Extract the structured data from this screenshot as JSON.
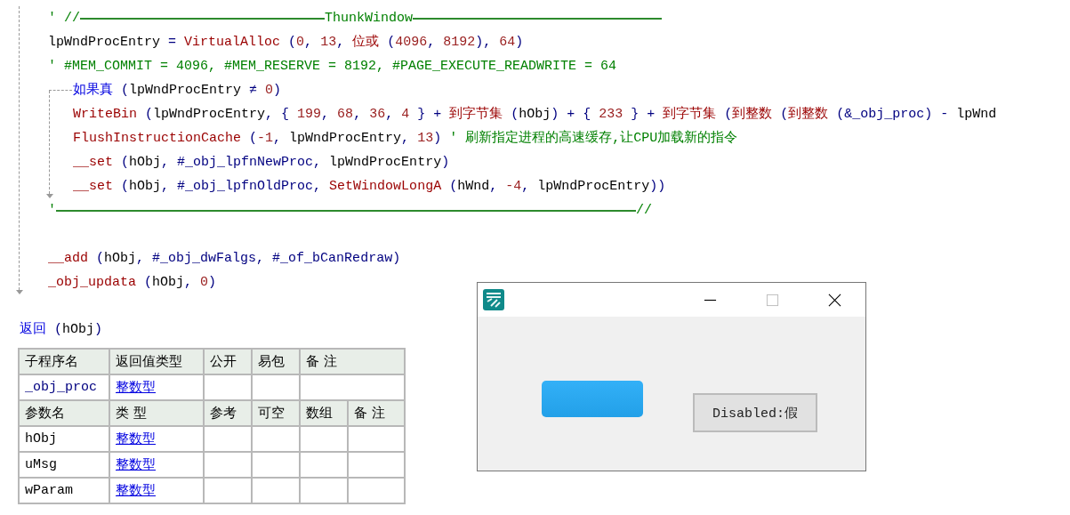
{
  "code": [
    {
      "kind": "rule",
      "prefix": "' //",
      "title": "ThunkWindow"
    },
    {
      "kind": "code",
      "tokens": [
        {
          "text": "lpWndProcEntry",
          "kind": "id"
        },
        {
          "text": " = ",
          "kind": "op"
        },
        {
          "text": "VirtualAlloc",
          "kind": "fn"
        },
        {
          "text": " (",
          "kind": "op"
        },
        {
          "text": "0",
          "kind": "num"
        },
        {
          "text": ", ",
          "kind": "op"
        },
        {
          "text": "13",
          "kind": "num"
        },
        {
          "text": ", ",
          "kind": "op"
        },
        {
          "text": "位或",
          "kind": "fn"
        },
        {
          "text": " (",
          "kind": "op"
        },
        {
          "text": "4096",
          "kind": "num"
        },
        {
          "text": ", ",
          "kind": "op"
        },
        {
          "text": "8192",
          "kind": "num"
        },
        {
          "text": "), ",
          "kind": "op"
        },
        {
          "text": "64",
          "kind": "num"
        },
        {
          "text": ")",
          "kind": "op"
        }
      ]
    },
    {
      "kind": "code",
      "tokens": [
        {
          "text": "' #MEM_COMMIT = 4096, #MEM_RESERVE = 8192, #PAGE_EXECUTE_READWRITE = 64",
          "kind": "comment"
        }
      ]
    },
    {
      "kind": "block",
      "tokens": [
        {
          "text": "如果真",
          "kind": "kw"
        },
        {
          "text": " (",
          "kind": "op"
        },
        {
          "text": "lpWndProcEntry",
          "kind": "id"
        },
        {
          "text": " ≠ ",
          "kind": "op"
        },
        {
          "text": "0",
          "kind": "num"
        },
        {
          "text": ")",
          "kind": "op"
        }
      ],
      "children": [
        {
          "kind": "code",
          "tokens": [
            {
              "text": "WriteBin",
              "kind": "fn"
            },
            {
              "text": " (",
              "kind": "op"
            },
            {
              "text": "lpWndProcEntry",
              "kind": "id"
            },
            {
              "text": ", { ",
              "kind": "op"
            },
            {
              "text": "199",
              "kind": "num"
            },
            {
              "text": ", ",
              "kind": "op"
            },
            {
              "text": "68",
              "kind": "num"
            },
            {
              "text": ", ",
              "kind": "op"
            },
            {
              "text": "36",
              "kind": "num"
            },
            {
              "text": ", ",
              "kind": "op"
            },
            {
              "text": "4",
              "kind": "num"
            },
            {
              "text": " } + ",
              "kind": "op"
            },
            {
              "text": "到字节集",
              "kind": "fn"
            },
            {
              "text": " (",
              "kind": "op"
            },
            {
              "text": "hObj",
              "kind": "id"
            },
            {
              "text": ") + { ",
              "kind": "op"
            },
            {
              "text": "233",
              "kind": "num"
            },
            {
              "text": " } + ",
              "kind": "op"
            },
            {
              "text": "到字节集",
              "kind": "fn"
            },
            {
              "text": " (",
              "kind": "op"
            },
            {
              "text": "到整数",
              "kind": "fn"
            },
            {
              "text": " (",
              "kind": "op"
            },
            {
              "text": "到整数",
              "kind": "fn"
            },
            {
              "text": " (",
              "kind": "op"
            },
            {
              "text": "&_obj_proc",
              "kind": "op"
            },
            {
              "text": ") - ",
              "kind": "op"
            },
            {
              "text": "lpWnd",
              "kind": "id"
            }
          ]
        },
        {
          "kind": "code",
          "tokens": [
            {
              "text": "FlushInstructionCache",
              "kind": "fn"
            },
            {
              "text": " (",
              "kind": "op"
            },
            {
              "text": "-1",
              "kind": "num"
            },
            {
              "text": ", ",
              "kind": "op"
            },
            {
              "text": "lpWndProcEntry",
              "kind": "id"
            },
            {
              "text": ", ",
              "kind": "op"
            },
            {
              "text": "13",
              "kind": "num"
            },
            {
              "text": ")",
              "kind": "op"
            },
            {
              "text": "  ' 刷新指定进程的高速缓存,让CPU加载新的指令",
              "kind": "comment"
            }
          ]
        },
        {
          "kind": "code",
          "tokens": [
            {
              "text": "__set",
              "kind": "fn"
            },
            {
              "text": " (",
              "kind": "op"
            },
            {
              "text": "hObj",
              "kind": "id"
            },
            {
              "text": ", ",
              "kind": "op"
            },
            {
              "text": "#_obj_lpfnNewProc",
              "kind": "op"
            },
            {
              "text": ", ",
              "kind": "op"
            },
            {
              "text": "lpWndProcEntry",
              "kind": "id"
            },
            {
              "text": ")",
              "kind": "op"
            }
          ]
        },
        {
          "kind": "code",
          "tokens": [
            {
              "text": "__set",
              "kind": "fn"
            },
            {
              "text": " (",
              "kind": "op"
            },
            {
              "text": "hObj",
              "kind": "id"
            },
            {
              "text": ", ",
              "kind": "op"
            },
            {
              "text": "#_obj_lpfnOldProc",
              "kind": "op"
            },
            {
              "text": ", ",
              "kind": "op"
            },
            {
              "text": "SetWindowLongA",
              "kind": "fn"
            },
            {
              "text": " (",
              "kind": "op"
            },
            {
              "text": "hWnd",
              "kind": "id"
            },
            {
              "text": ", ",
              "kind": "op"
            },
            {
              "text": "-4",
              "kind": "num"
            },
            {
              "text": ", ",
              "kind": "op"
            },
            {
              "text": "lpWndProcEntry",
              "kind": "id"
            },
            {
              "text": "))",
              "kind": "op"
            }
          ]
        }
      ]
    },
    {
      "kind": "rule_end",
      "prefix": "'",
      "suffix": "//"
    },
    {
      "kind": "blank"
    },
    {
      "kind": "code",
      "tokens": [
        {
          "text": "__add",
          "kind": "fn"
        },
        {
          "text": " (",
          "kind": "op"
        },
        {
          "text": "hObj",
          "kind": "id"
        },
        {
          "text": ", ",
          "kind": "op"
        },
        {
          "text": "#_obj_dwFalgs",
          "kind": "op"
        },
        {
          "text": ", ",
          "kind": "op"
        },
        {
          "text": "#_of_bCanRedraw",
          "kind": "op"
        },
        {
          "text": ")",
          "kind": "op"
        }
      ]
    },
    {
      "kind": "code",
      "tokens": [
        {
          "text": "_obj_updata",
          "kind": "fn"
        },
        {
          "text": " (",
          "kind": "op"
        },
        {
          "text": "hObj",
          "kind": "id"
        },
        {
          "text": ", ",
          "kind": "op"
        },
        {
          "text": "0",
          "kind": "num"
        },
        {
          "text": ")",
          "kind": "op"
        }
      ]
    }
  ],
  "return_line": [
    {
      "text": "返回",
      "kind": "kw"
    },
    {
      "text": " (",
      "kind": "op"
    },
    {
      "text": "hObj",
      "kind": "id"
    },
    {
      "text": ")",
      "kind": "op"
    }
  ],
  "proc_table": {
    "columns": [
      "子程序名",
      "返回值类型",
      "公开",
      "易包",
      "备 注"
    ],
    "row": {
      "name": "_obj_proc",
      "type": "整数型"
    }
  },
  "param_table": {
    "columns": [
      "参数名",
      "类 型",
      "参考",
      "可空",
      "数组",
      "备 注"
    ],
    "rows": [
      {
        "name": "hObj",
        "type": "整数型"
      },
      {
        "name": "uMsg",
        "type": "整数型"
      },
      {
        "name": "wParam",
        "type": "整数型"
      }
    ]
  },
  "dialog": {
    "buttons": [
      {
        "kind": "styled"
      },
      {
        "kind": "standard",
        "label": "Disabled:假"
      }
    ]
  }
}
